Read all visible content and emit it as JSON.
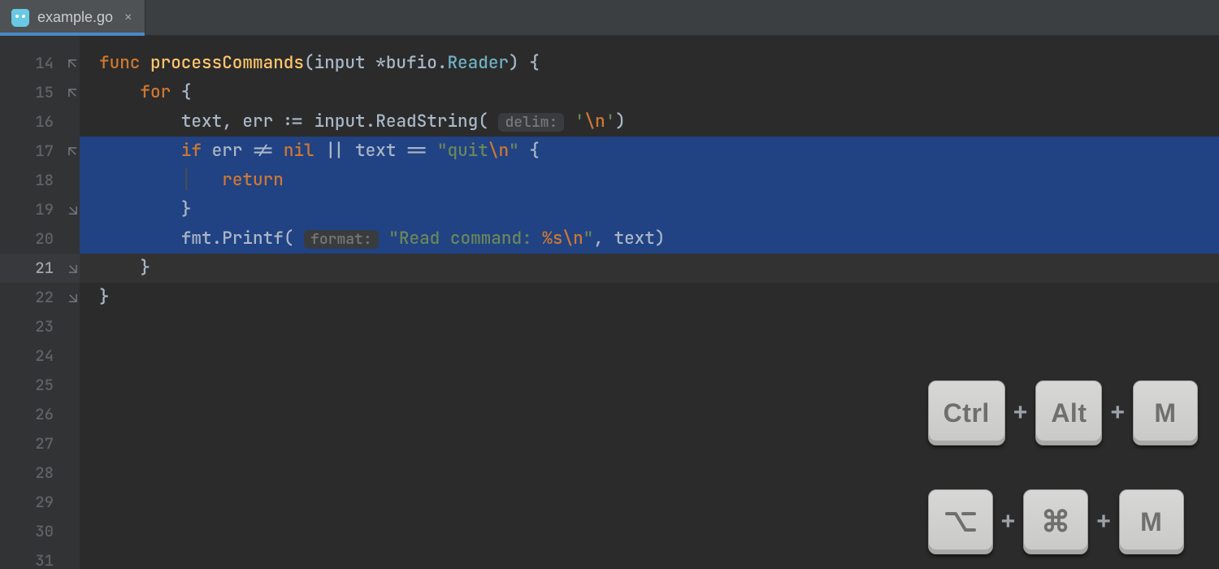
{
  "tab": {
    "filename": "example.go",
    "close_glyph": "×",
    "icon_name": "go-file-icon"
  },
  "gutter": {
    "start": 14,
    "end": 31,
    "current_line": 21,
    "selected_lines": [
      17,
      18,
      19,
      20
    ],
    "fold_marks": {
      "14": "open",
      "15": "open",
      "17": "open",
      "19": "close",
      "21": "close",
      "22": "close"
    }
  },
  "code": {
    "lines": {
      "14": [
        {
          "cls": "kw",
          "t": "func "
        },
        {
          "cls": "fnname",
          "t": "processCommands"
        },
        {
          "cls": "punct",
          "t": "("
        },
        {
          "cls": "ident",
          "t": "input "
        },
        {
          "cls": "punct",
          "t": "*"
        },
        {
          "cls": "ident",
          "t": "bufio"
        },
        {
          "cls": "punct",
          "t": "."
        },
        {
          "cls": "type",
          "t": "Reader"
        },
        {
          "cls": "punct",
          "t": ") {"
        }
      ],
      "15": [
        {
          "cls": "",
          "t": "    "
        },
        {
          "cls": "kw",
          "t": "for "
        },
        {
          "cls": "punct",
          "t": "{"
        }
      ],
      "16": [
        {
          "cls": "",
          "t": "        "
        },
        {
          "cls": "ident",
          "t": "text"
        },
        {
          "cls": "punct",
          "t": ", "
        },
        {
          "cls": "ident",
          "t": "err "
        },
        {
          "cls": "op",
          "t": ":= "
        },
        {
          "cls": "ident",
          "t": "input"
        },
        {
          "cls": "punct",
          "t": "."
        },
        {
          "cls": "ident",
          "t": "ReadString"
        },
        {
          "cls": "punct",
          "t": "( "
        },
        {
          "cls": "hint",
          "t": "delim:"
        },
        {
          "cls": "",
          "t": " "
        },
        {
          "cls": "str",
          "t": "'"
        },
        {
          "cls": "escape",
          "t": "\\n"
        },
        {
          "cls": "str",
          "t": "'"
        },
        {
          "cls": "punct",
          "t": ")"
        }
      ],
      "17": [
        {
          "cls": "",
          "t": "        "
        },
        {
          "cls": "kw",
          "t": "if "
        },
        {
          "cls": "ident",
          "t": "err "
        },
        {
          "cls": "op",
          "t": "!= "
        },
        {
          "cls": "kw",
          "t": "nil "
        },
        {
          "cls": "op",
          "t": "|| "
        },
        {
          "cls": "ident",
          "t": "text "
        },
        {
          "cls": "op",
          "t": "== "
        },
        {
          "cls": "str",
          "t": "\"quit"
        },
        {
          "cls": "escape",
          "t": "\\n"
        },
        {
          "cls": "str",
          "t": "\""
        },
        {
          "cls": "punct",
          "t": " {"
        }
      ],
      "18": [
        {
          "cls": "",
          "t": "        "
        },
        {
          "cls": "guide",
          "t": "│   "
        },
        {
          "cls": "kw",
          "t": "return"
        }
      ],
      "19": [
        {
          "cls": "",
          "t": "        "
        },
        {
          "cls": "punct",
          "t": "}"
        }
      ],
      "20": [
        {
          "cls": "",
          "t": "        "
        },
        {
          "cls": "ident",
          "t": "fmt"
        },
        {
          "cls": "punct",
          "t": "."
        },
        {
          "cls": "ident",
          "t": "Printf"
        },
        {
          "cls": "punct",
          "t": "( "
        },
        {
          "cls": "hint",
          "t": "format:"
        },
        {
          "cls": "",
          "t": " "
        },
        {
          "cls": "str",
          "t": "\"Read command: "
        },
        {
          "cls": "escape",
          "t": "%s\\n"
        },
        {
          "cls": "str",
          "t": "\""
        },
        {
          "cls": "punct",
          "t": ", "
        },
        {
          "cls": "ident",
          "t": "text"
        },
        {
          "cls": "punct",
          "t": ")"
        }
      ],
      "21": [
        {
          "cls": "",
          "t": "    "
        },
        {
          "cls": "punct",
          "t": "}"
        }
      ],
      "22": [
        {
          "cls": "punct",
          "t": "}"
        }
      ]
    }
  },
  "shortcuts": {
    "rows": [
      {
        "keys": [
          "Ctrl",
          "Alt",
          "M"
        ],
        "types": [
          "text",
          "text",
          "text"
        ]
      },
      {
        "keys": [
          "option",
          "command",
          "M"
        ],
        "types": [
          "option-icon",
          "command-icon",
          "text"
        ]
      }
    ],
    "plus": "+",
    "glyphs": {
      "option-icon": "⌥",
      "command-icon": "⌘"
    }
  },
  "colors": {
    "background": "#2b2b2b",
    "gutter_background": "#313335",
    "tab_background": "#4e5254",
    "tab_underline": "#4a88c7",
    "selection": "#214283",
    "keyword": "#cc7832",
    "function": "#ffc66d",
    "type": "#6fb0c1",
    "string": "#6a8759"
  }
}
